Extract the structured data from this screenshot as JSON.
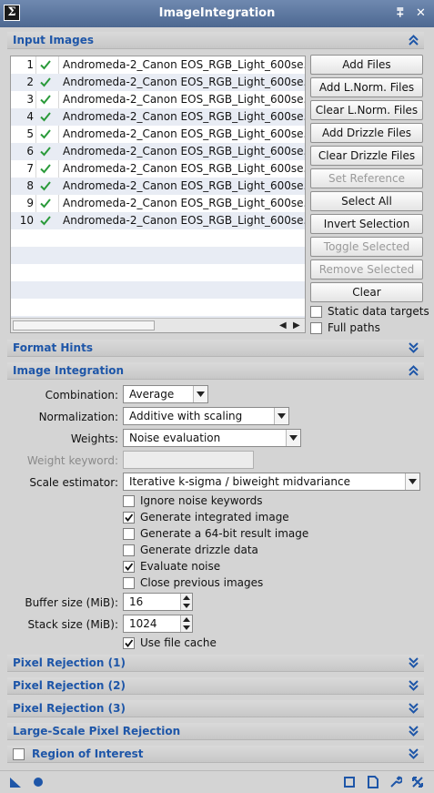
{
  "window": {
    "title": "ImageIntegration",
    "sigma_glyph": "Σ",
    "shade_glyph": "⩱",
    "close_glyph": "✕"
  },
  "sections": {
    "input_images": "Input Images",
    "format_hints": "Format Hints",
    "image_integration": "Image Integration",
    "pixel_rejection_1": "Pixel Rejection (1)",
    "pixel_rejection_2": "Pixel Rejection (2)",
    "pixel_rejection_3": "Pixel Rejection (3)",
    "large_scale": "Large-Scale Pixel Rejection",
    "roi": "Region of Interest"
  },
  "file_list": {
    "rows": [
      {
        "num": "1",
        "name": "Andromeda-2_Canon EOS_RGB_Light_600se..."
      },
      {
        "num": "2",
        "name": "Andromeda-2_Canon EOS_RGB_Light_600se..."
      },
      {
        "num": "3",
        "name": "Andromeda-2_Canon EOS_RGB_Light_600se..."
      },
      {
        "num": "4",
        "name": "Andromeda-2_Canon EOS_RGB_Light_600se..."
      },
      {
        "num": "5",
        "name": "Andromeda-2_Canon EOS_RGB_Light_600se..."
      },
      {
        "num": "6",
        "name": "Andromeda-2_Canon EOS_RGB_Light_600se..."
      },
      {
        "num": "7",
        "name": "Andromeda-2_Canon EOS_RGB_Light_600se..."
      },
      {
        "num": "8",
        "name": "Andromeda-2_Canon EOS_RGB_Light_600se..."
      },
      {
        "num": "9",
        "name": "Andromeda-2_Canon EOS_RGB_Light_600se..."
      },
      {
        "num": "10",
        "name": "Andromeda-2_Canon EOS_RGB_Light_600se..."
      }
    ],
    "scroll_left": "◀",
    "scroll_right": "▶"
  },
  "buttons": {
    "add_files": "Add Files",
    "add_lnorm": "Add L.Norm. Files",
    "clear_lnorm": "Clear L.Norm. Files",
    "add_drizzle": "Add Drizzle Files",
    "clear_drizzle": "Clear Drizzle Files",
    "set_reference": "Set Reference",
    "select_all": "Select All",
    "invert_selection": "Invert Selection",
    "toggle_selected": "Toggle Selected",
    "remove_selected": "Remove Selected",
    "clear": "Clear"
  },
  "input_options": {
    "static_data_targets": "Static data targets",
    "full_paths": "Full paths"
  },
  "integration": {
    "combination_label": "Combination:",
    "combination_value": "Average",
    "normalization_label": "Normalization:",
    "normalization_value": "Additive with scaling",
    "weights_label": "Weights:",
    "weights_value": "Noise evaluation",
    "weight_keyword_label": "Weight keyword:",
    "scale_estimator_label": "Scale estimator:",
    "scale_estimator_value": "Iterative k-sigma / biweight midvariance",
    "ignore_noise_keywords": "Ignore noise keywords",
    "generate_integrated_image": "Generate integrated image",
    "generate_64bit": "Generate a 64-bit result image",
    "generate_drizzle": "Generate drizzle data",
    "evaluate_noise": "Evaluate noise",
    "close_previous": "Close previous images",
    "buffer_size_label": "Buffer size (MiB):",
    "buffer_size_value": "16",
    "stack_size_label": "Stack size (MiB):",
    "stack_size_value": "1024",
    "use_file_cache": "Use file cache"
  },
  "colors": {
    "section_label": "#1e56a8",
    "check_green": "#2a9a3a",
    "title_bar": "#5a7499"
  }
}
